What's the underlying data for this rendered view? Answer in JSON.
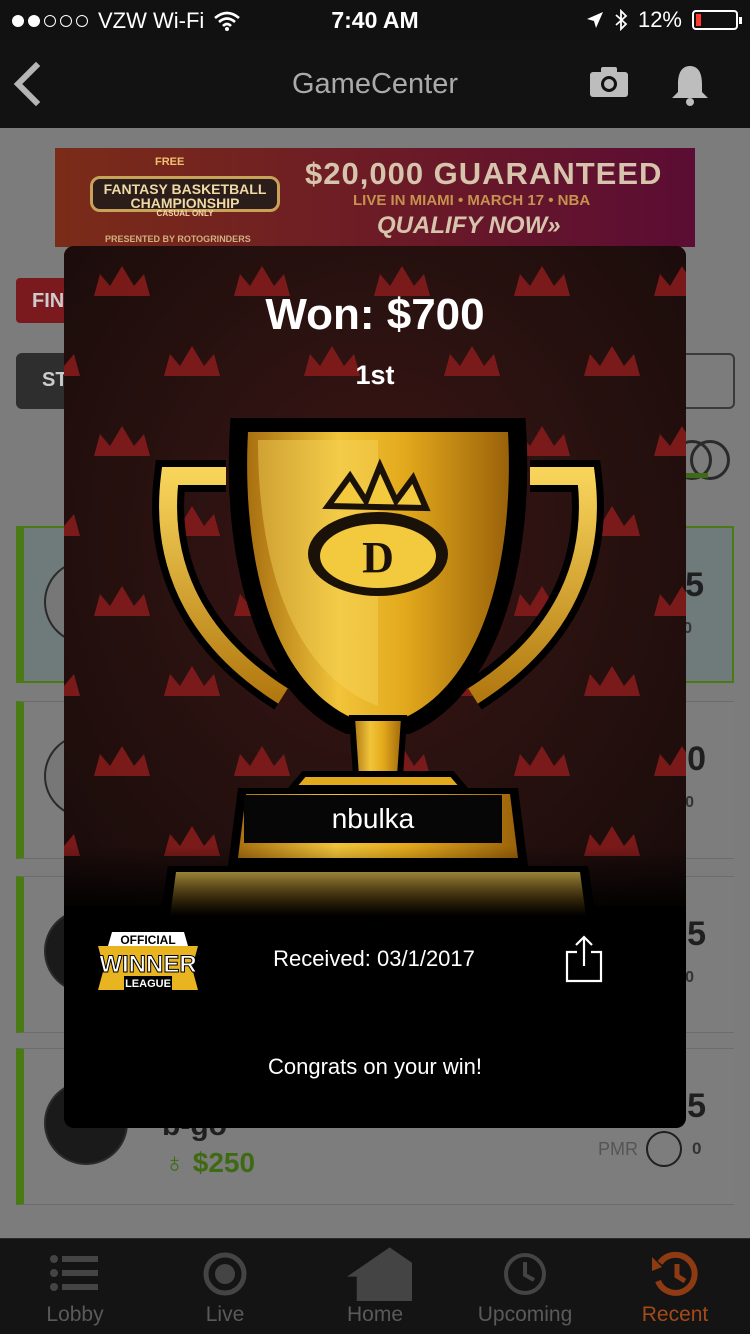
{
  "status_bar": {
    "carrier": "VZW Wi-Fi",
    "time": "7:40 AM",
    "battery_percent": "12%",
    "battery_level": 0.12,
    "signal_bars_filled": 2,
    "signal_bars_total": 5
  },
  "nav": {
    "title": "GameCenter",
    "back_icon": "chevron-left-icon",
    "camera_icon": "camera-icon",
    "bell_icon": "bell-icon"
  },
  "ad": {
    "free": "FREE",
    "logo_line1": "FANTASY BASKETBALL",
    "logo_line2": "CHAMPIONSHIP",
    "logo_line3": "CASUAL ONLY",
    "presented_by": "PRESENTED BY ROTOGRINDERS",
    "headline": "$20,000 GUARANTEED",
    "subline": "LIVE IN MIAMI • MARCH 17 • NBA",
    "cta": "QUALIFY NOW»"
  },
  "background": {
    "filter_label": "FIN",
    "sort_label": "ST",
    "cards": [
      {
        "right_value": "75",
        "right_sub": "0"
      },
      {
        "right_value": "00",
        "right_sub": "0"
      },
      {
        "right_value": "75",
        "right_sub": "0"
      },
      {
        "right_value": "75",
        "name": "b-go",
        "money": "$250",
        "pmr_label": "PMR",
        "pmr_value": "0"
      }
    ]
  },
  "modal": {
    "won": "Won: $700",
    "place": "1st",
    "username": "nbulka",
    "badge_line1": "OFFICIAL",
    "badge_line2": "WINNER",
    "badge_line3": "LEAGUE",
    "received": "Received: 03/1/2017",
    "share_icon": "share-icon",
    "congrats": "Congrats on your win!",
    "colors": {
      "gold": "#e6b21f",
      "crown_red": "#8a1c1c",
      "bg_dark": "#1a0c0b"
    }
  },
  "tabs": [
    {
      "label": "Lobby",
      "icon": "list-icon",
      "active": false
    },
    {
      "label": "Live",
      "icon": "target-icon",
      "active": false
    },
    {
      "label": "Home",
      "icon": "home-icon",
      "active": false
    },
    {
      "label": "Upcoming",
      "icon": "clock-icon",
      "active": false
    },
    {
      "label": "Recent",
      "icon": "history-icon",
      "active": true
    }
  ]
}
